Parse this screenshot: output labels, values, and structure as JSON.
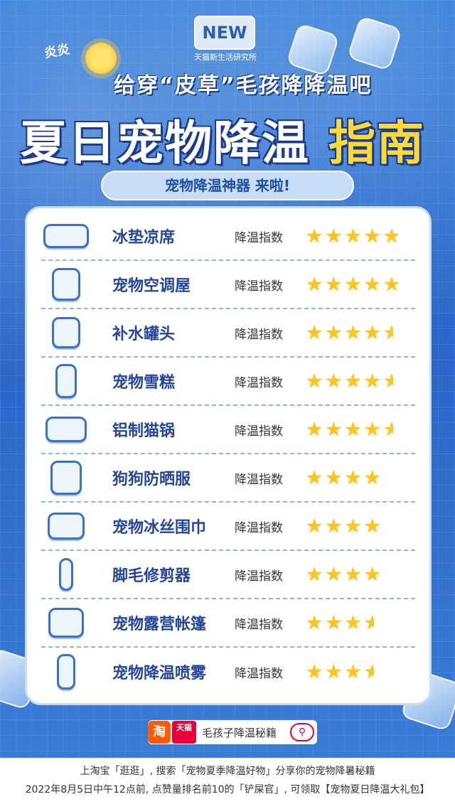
{
  "brand": {
    "logo_text": "NEW",
    "logo_sub": "天猫新生活研究所"
  },
  "header": {
    "hot_text": "炎炎",
    "subtitle": "给穿“皮草”毛孩降降温吧",
    "title_main": "夏日宠物降温",
    "title_highlight": "指南",
    "pill_text": "宠物降温神器 来啦!"
  },
  "items": [
    {
      "name": "冰垫凉席",
      "label": "降温指数",
      "rating": 5,
      "icon": "cooling-mat-icon"
    },
    {
      "name": "宠物空调屋",
      "label": "降温指数",
      "rating": 5,
      "icon": "ac-house-icon"
    },
    {
      "name": "补水罐头",
      "label": "降温指数",
      "rating": 4.5,
      "icon": "water-can-icon"
    },
    {
      "name": "宠物雪糕",
      "label": "降温指数",
      "rating": 4.5,
      "icon": "ice-cream-icon"
    },
    {
      "name": "铝制猫锅",
      "label": "降温指数",
      "rating": 4.5,
      "icon": "cat-pot-icon"
    },
    {
      "name": "狗狗防晒服",
      "label": "降温指数",
      "rating": 4,
      "icon": "dog-suit-icon"
    },
    {
      "name": "宠物冰丝围巾",
      "label": "降温指数",
      "rating": 4,
      "icon": "scarf-icon"
    },
    {
      "name": "脚毛修剪器",
      "label": "降温指数",
      "rating": 4,
      "icon": "trimmer-icon"
    },
    {
      "name": "宠物露营帐篷",
      "label": "降温指数",
      "rating": 3.5,
      "icon": "tent-icon"
    },
    {
      "name": "宠物降温喷雾",
      "label": "降温指数",
      "rating": 3.5,
      "icon": "spray-icon"
    }
  ],
  "search": {
    "taobao": "淘",
    "tmall": "天猫",
    "query": "毛孩子降温秘籍",
    "icon": "search-icon"
  },
  "footer": {
    "line1": "上淘宝「逛逛」, 搜索「宠物夏季降温好物」分享你的宠物降暑秘籍",
    "line2": "2022年8月5日中午12点前, 点赞量排名前10的「铲屎官」, 可领取【宠物夏日降温大礼包】"
  },
  "colors": {
    "background": "#2f6fd0",
    "title_highlight": "#ffd93a",
    "star": "#ffc51a",
    "item_text": "#24459a"
  }
}
